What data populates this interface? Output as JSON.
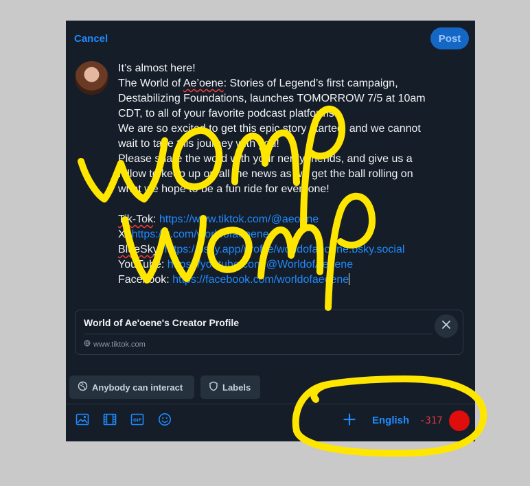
{
  "header": {
    "cancel_label": "Cancel",
    "post_label": "Post"
  },
  "post": {
    "line1": "It’s almost here!",
    "line2_pre": "The World of ",
    "line2_word": "Ae’oene",
    "line2_post": ": Stories of Legend’s first campaign,",
    "line3": "Destabilizing Foundations, launches TOMORROW 7/5 at 10am",
    "line4": "CDT, to all of your favorite podcast platforms.",
    "line5": "We are so excited to get this epic story started, and we cannot",
    "line6": "wait to take this journey with you!",
    "line7": "Please share the word with your nerdy friends, and give us a",
    "line8": "follow to keep up on all the news as we get the ball rolling on",
    "line9": "what we hope to be a fun ride for everyone!",
    "links": [
      {
        "label": "Tik-Tok",
        "url": "https://www.tiktok.com/@aeoene"
      },
      {
        "label": "X",
        "url": "https://x.com/worldofaeoene"
      },
      {
        "label": "BlueSky",
        "url": "https://bsky.app/profile/worldofaeoene.bsky.social"
      },
      {
        "label": "YouTube",
        "url": "https://youtube.com/@WorldofAeoene"
      },
      {
        "label": "Facebook",
        "url": "https://facebook.com/worldofaeoene"
      }
    ]
  },
  "link_card": {
    "title": "World of Ae'oene's Creator Profile",
    "domain": "www.tiktok.com"
  },
  "chips": {
    "interact_label": "Anybody can interact",
    "labels_label": "Labels"
  },
  "footer": {
    "language": "English",
    "char_count": "-317",
    "count_color": "#e23b3b",
    "accent": "#1f8bff"
  },
  "icons": [
    "image-icon",
    "video-icon",
    "gif-icon",
    "emoji-icon",
    "plus-icon",
    "close-icon",
    "globe-icon",
    "shield-icon"
  ],
  "annotation": {
    "scribble_text": "Womp Womp",
    "color": "#ffe600"
  }
}
